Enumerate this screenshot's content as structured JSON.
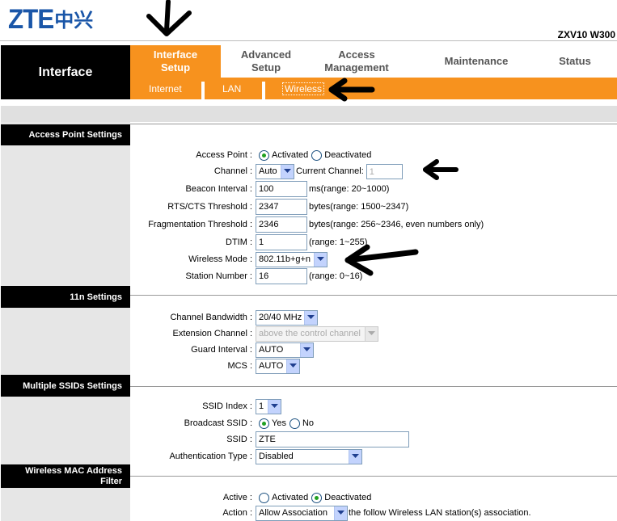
{
  "brand": {
    "logo_latin": "ZTE",
    "logo_cn": "中兴",
    "model": "ZXV10 W300",
    "color": "#1a56a8"
  },
  "menu": {
    "section": "Interface",
    "tabs": [
      {
        "label": "Interface Setup",
        "active": true
      },
      {
        "label": "Advanced Setup",
        "active": false
      },
      {
        "label": "Access Management",
        "active": false
      },
      {
        "label": "Maintenance",
        "active": false
      },
      {
        "label": "Status",
        "active": false
      }
    ],
    "subtabs": [
      {
        "label": "Internet",
        "selected": false
      },
      {
        "label": "LAN",
        "selected": false
      },
      {
        "label": "Wireless",
        "selected": true
      }
    ],
    "accent": "#f7921e"
  },
  "ap": {
    "header": "Access Point Settings",
    "access_point": {
      "label": "Access Point :",
      "opt1": "Activated",
      "opt2": "Deactivated",
      "selected": "Activated"
    },
    "channel": {
      "label": "Channel :",
      "value": "Auto",
      "current_label": "Current Channel:",
      "current_value": "1"
    },
    "beacon": {
      "label": "Beacon Interval :",
      "value": "100",
      "hint": "ms(range: 20~1000)"
    },
    "rts": {
      "label": "RTS/CTS Threshold :",
      "value": "2347",
      "hint": "bytes(range: 1500~2347)"
    },
    "frag": {
      "label": "Fragmentation Threshold :",
      "value": "2346",
      "hint": "bytes(range: 256~2346, even numbers only)"
    },
    "dtim": {
      "label": "DTIM :",
      "value": "1",
      "hint": "(range: 1~255)"
    },
    "mode": {
      "label": "Wireless Mode :",
      "value": "802.11b+g+n"
    },
    "station": {
      "label": "Station Number :",
      "value": "16",
      "hint": "(range: 0~16)"
    }
  },
  "n11": {
    "header": "11n Settings",
    "bandwidth": {
      "label": "Channel Bandwidth :",
      "value": "20/40 MHz"
    },
    "extension": {
      "label": "Extension Channel :",
      "value": "above the control channel"
    },
    "guard": {
      "label": "Guard Interval :",
      "value": "AUTO"
    },
    "mcs": {
      "label": "MCS :",
      "value": "AUTO"
    }
  },
  "ssid": {
    "header": "Multiple SSIDs Settings",
    "index": {
      "label": "SSID Index :",
      "value": "1"
    },
    "broadcast": {
      "label": "Broadcast SSID :",
      "opt1": "Yes",
      "opt2": "No",
      "selected": "Yes"
    },
    "ssid": {
      "label": "SSID :",
      "value": "ZTE"
    },
    "auth": {
      "label": "Authentication Type :",
      "value": "Disabled"
    }
  },
  "mac": {
    "header1": "Wireless MAC Address",
    "header2": "Filter",
    "active": {
      "label": "Active :",
      "opt1": "Activated",
      "opt2": "Deactivated",
      "selected": "Deactivated"
    },
    "action": {
      "label": "Action :",
      "value": "Allow Association",
      "hint": "the follow Wireless LAN station(s) association."
    }
  }
}
